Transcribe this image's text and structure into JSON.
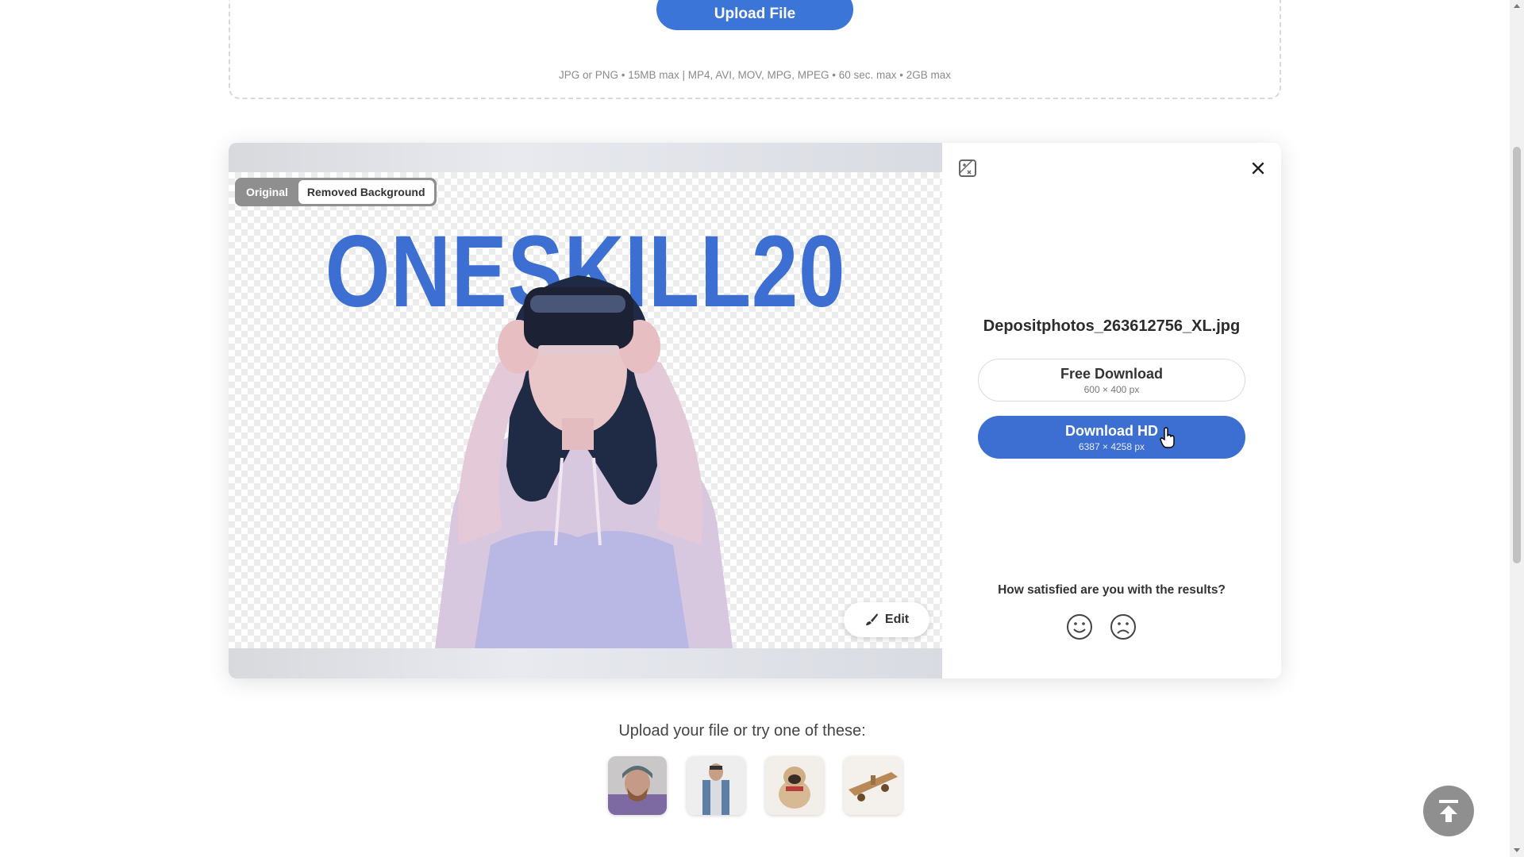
{
  "upload": {
    "button_label": "Upload File",
    "formats": "JPG or PNG • 15MB max | MP4, AVI, MOV, MPG, MPEG • 60 sec. max • 2GB max"
  },
  "preview": {
    "toggle_original": "Original",
    "toggle_removed": "Removed Background",
    "active_view": "Removed Background",
    "image_text": "ONESKILL20",
    "edit_label": "Edit"
  },
  "side": {
    "filename": "Depositphotos_263612756_XL.jpg",
    "free_download": {
      "label": "Free Download",
      "size": "600 × 400 px"
    },
    "hd_download": {
      "label": "Download HD",
      "size": "6387 × 4258 px"
    },
    "feedback_question": "How satisfied are you with the results?"
  },
  "samples": {
    "label": "Upload your file or try one of these:",
    "items": [
      "man-with-helmet",
      "man-in-vest",
      "pug-dog",
      "wooden-object"
    ]
  },
  "colors": {
    "accent": "#3c6fd1",
    "upload_button": "#3c75d8",
    "scroll_top_button": "#8f8f8f"
  }
}
